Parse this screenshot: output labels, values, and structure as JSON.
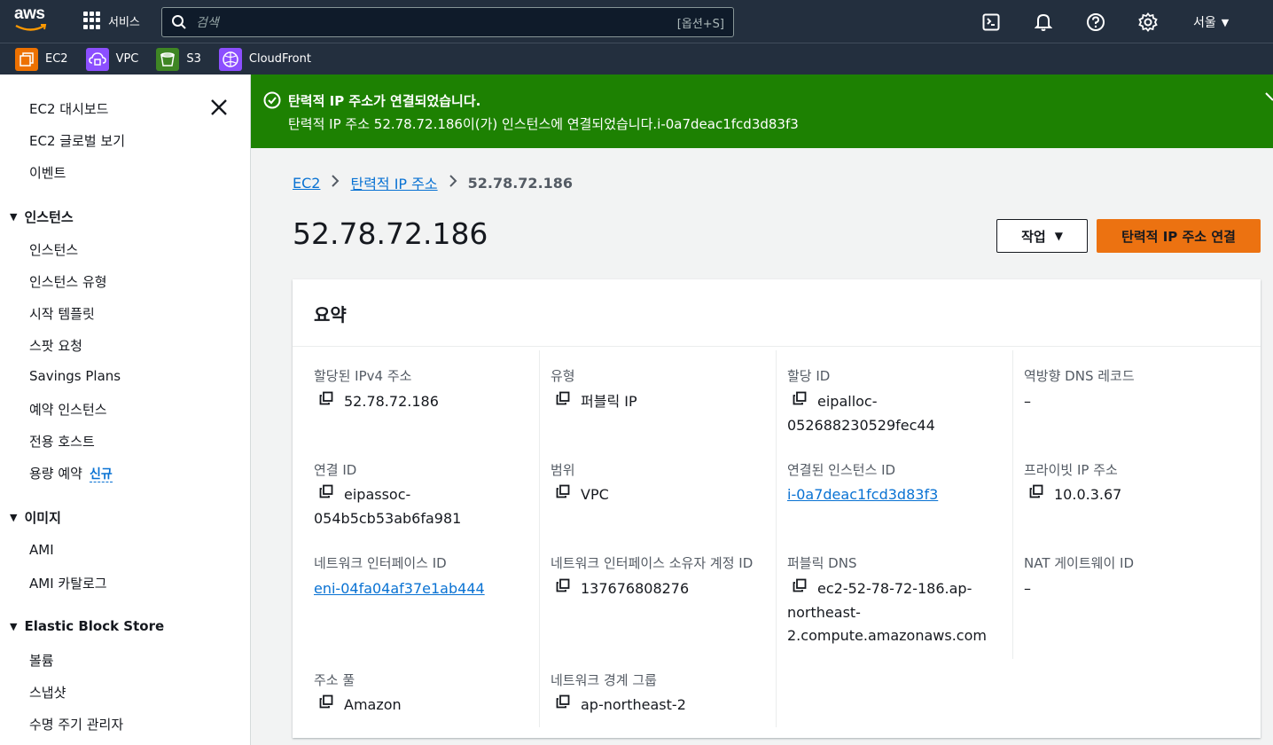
{
  "topnav": {
    "logo_text": "aws",
    "services_label": "서비스",
    "search_placeholder": "검색",
    "search_shortcut": "[옵션+S]",
    "region_label": "서울",
    "icons": [
      "cloudshell-icon",
      "bell-icon",
      "help-icon",
      "settings-icon"
    ]
  },
  "favorites": [
    {
      "label": "EC2",
      "color": "#ed7100"
    },
    {
      "label": "VPC",
      "color": "#8c4fff"
    },
    {
      "label": "S3",
      "color": "#3f8624"
    },
    {
      "label": "CloudFront",
      "color": "#8c4fff"
    }
  ],
  "sidebar": {
    "top_items": [
      "EC2 대시보드",
      "EC2 글로벌 보기",
      "이벤트"
    ],
    "sections": [
      {
        "title": "인스턴스",
        "items": [
          "인스턴스",
          "인스턴스 유형",
          "시작 템플릿",
          "스팟 요청",
          "Savings Plans",
          "예약 인스턴스",
          "전용 호스트",
          "용량 예약"
        ]
      },
      {
        "title": "이미지",
        "items": [
          "AMI",
          "AMI 카탈로그"
        ]
      },
      {
        "title": "Elastic Block Store",
        "items": [
          "볼륨",
          "스냅샷",
          "수명 주기 관리자"
        ]
      }
    ],
    "new_badge": "신규"
  },
  "banner": {
    "title": "탄력적 IP 주소가 연결되었습니다.",
    "description": "탄력적 IP 주소 52.78.72.186이(가) 인스턴스에 연결되었습니다.i-0a7deac1fcd3d83f3",
    "color": "#1d8102"
  },
  "breadcrumb": {
    "items": [
      "EC2",
      "탄력적 IP 주소"
    ],
    "current": "52.78.72.186"
  },
  "page": {
    "title": "52.78.72.186",
    "actions_label": "작업",
    "primary_label": "탄력적 IP 주소 연결"
  },
  "summary": {
    "title": "요약",
    "fields": {
      "ipv4": {
        "label": "할당된 IPv4 주소",
        "value": "52.78.72.186"
      },
      "type": {
        "label": "유형",
        "value": "퍼블릭 IP"
      },
      "alloc_id": {
        "label": "할당 ID",
        "value_line1": "eipalloc-",
        "value_line2": "052688230529fec44"
      },
      "reverse_dns": {
        "label": "역방향 DNS 레코드",
        "value": "–"
      },
      "assoc_id": {
        "label": "연결 ID",
        "value_line1": "eipassoc-",
        "value_line2": "054b5cb53ab6fa981"
      },
      "scope": {
        "label": "범위",
        "value": "VPC"
      },
      "instance_id": {
        "label": "연결된 인스턴스 ID",
        "value": "i-0a7deac1fcd3d83f3"
      },
      "private_ip": {
        "label": "프라이빗 IP 주소",
        "value": "10.0.3.67"
      },
      "eni_id": {
        "label": "네트워크 인터페이스 ID",
        "value": "eni-04fa04af37e1ab444"
      },
      "eni_owner": {
        "label": "네트워크 인터페이스 소유자 계정 ID",
        "value": "137676808276"
      },
      "public_dns": {
        "label": "퍼블릭 DNS",
        "value_line1": "ec2-52-78-72-186.ap-",
        "value_line2": "northeast-",
        "value_line3": "2.compute.amazonaws.com"
      },
      "nat_gw": {
        "label": "NAT 게이트웨이 ID",
        "value": "–"
      },
      "pool": {
        "label": "주소 풀",
        "value": "Amazon"
      },
      "border_group": {
        "label": "네트워크 경계 그룹",
        "value": "ap-northeast-2"
      }
    }
  }
}
